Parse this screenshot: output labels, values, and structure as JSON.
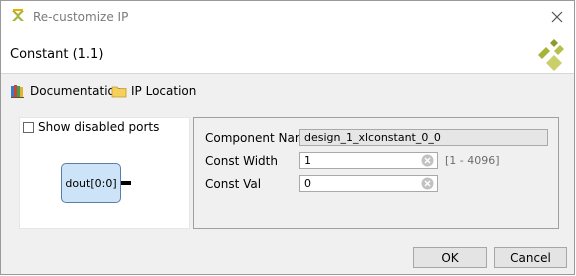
{
  "window": {
    "title": "Re-customize IP",
    "title_icon": "xilinx-icon",
    "close_icon": "close-icon"
  },
  "header": {
    "ip_name": "Constant (1.1)",
    "logo_icon": "xilinx-logo",
    "logo_color": "#a8b437"
  },
  "toolbar": {
    "documentation_label": "Documentation",
    "documentation_icon": "books-icon",
    "ip_location_label": "IP Location",
    "ip_location_icon": "folder-icon"
  },
  "symbol_panel": {
    "show_disabled_ports_label": "Show disabled ports",
    "show_disabled_ports_checked": false,
    "block_port_label": "dout[0:0]",
    "block_fill": "#cde3f7",
    "block_border": "#5a7ea8"
  },
  "config": {
    "component_name_label": "Component Name",
    "component_name_value": "design_1_xlconstant_0_0",
    "const_width_label": "Const Width",
    "const_width_value": "1",
    "const_width_range": "[1 - 4096]",
    "const_val_label": "Const Val",
    "const_val_value": "0"
  },
  "footer": {
    "ok_label": "OK",
    "cancel_label": "Cancel"
  }
}
